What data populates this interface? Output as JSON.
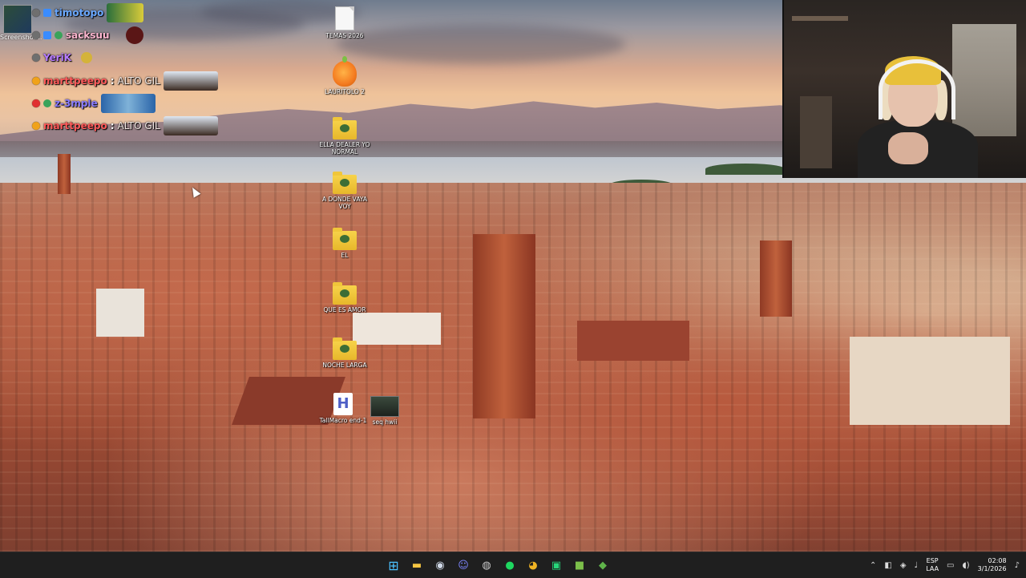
{
  "chat": {
    "messages": [
      {
        "user": "timotopo",
        "user_color": "#6aa8ff",
        "text": "",
        "dot_color": "#6f6f6f"
      },
      {
        "user": "sacksuu",
        "user_color": "#ffb7d0",
        "text": "",
        "dot_color": "#6f6f6f"
      },
      {
        "user": "YeriK",
        "user_color": "#b57bff",
        "text": "",
        "dot_color": "#6f6f6f"
      },
      {
        "user": "marttpeepo",
        "user_color": "#ff5a5a",
        "text": "ALTO GIL",
        "dot_color": "#f0a21a"
      },
      {
        "user": "z-3mple",
        "user_color": "#8a7cff",
        "text": "",
        "dot_color": "#e03030"
      },
      {
        "user": "marttpeepo",
        "user_color": "#ff5a5a",
        "text": "ALTO GIL",
        "dot_color": "#f0a21a"
      }
    ],
    "screenshot_label": "Screenshot..."
  },
  "desktop": {
    "icons": [
      {
        "label": "TEMAS 2026",
        "kind": "file"
      },
      {
        "label": "LAURITOLO 2",
        "kind": "fl-studio"
      },
      {
        "label": "ELLA DEALER YO NORMAL",
        "kind": "folder"
      },
      {
        "label": "A DONDE VAYA VOY",
        "kind": "folder"
      },
      {
        "label": "EL",
        "kind": "folder"
      },
      {
        "label": "QUE ES AMOR",
        "kind": "folder"
      },
      {
        "label": "NOCHE LARGA",
        "kind": "folder"
      },
      {
        "label": "TallMacro end-1",
        "kind": "tallmacro"
      },
      {
        "label": "seq hwii",
        "kind": "shortcut"
      }
    ]
  },
  "taskbar": {
    "apps": [
      {
        "name": "start",
        "glyph": "⊞",
        "color": "#4cc2ff"
      },
      {
        "name": "file-explorer",
        "glyph": "▬",
        "color": "#f5c542"
      },
      {
        "name": "steam",
        "glyph": "◉",
        "color": "#cfd8e6"
      },
      {
        "name": "discord",
        "glyph": "☺",
        "color": "#7d86ff"
      },
      {
        "name": "obs",
        "glyph": "◍",
        "color": "#c8c8c8"
      },
      {
        "name": "spotify",
        "glyph": "●",
        "color": "#1ed760"
      },
      {
        "name": "chrome",
        "glyph": "◕",
        "color": "#f0b323"
      },
      {
        "name": "capcut",
        "glyph": "▣",
        "color": "#27d77a"
      },
      {
        "name": "minecraft",
        "glyph": "■",
        "color": "#7cbf4a"
      },
      {
        "name": "minecraft-launcher",
        "glyph": "◆",
        "color": "#5fb34a"
      }
    ],
    "language": "ESP",
    "language_sub": "LAA",
    "time": "02:08",
    "date": "3/1/2026"
  }
}
